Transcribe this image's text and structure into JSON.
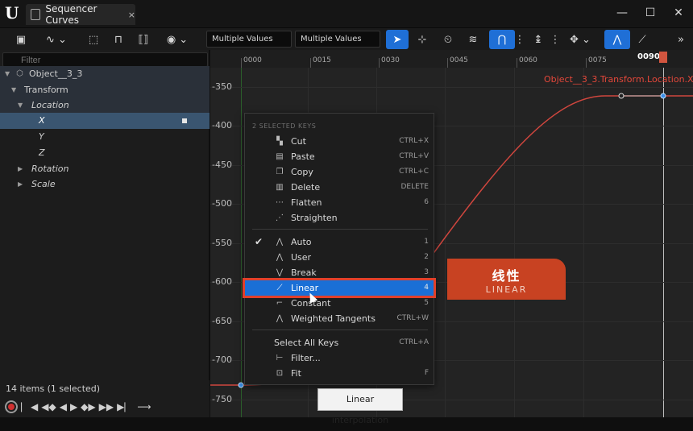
{
  "window": {
    "tab_title": "Sequencer Curves",
    "close_tab": "×",
    "minimize": "—",
    "maximize": "☐",
    "close": "✕"
  },
  "toolbar": {
    "input1": "Multiple Values",
    "input2": "Multiple Values"
  },
  "left_panel": {
    "filter_placeholder": "Filter",
    "tree": [
      {
        "label": "Object__3_3",
        "level": 0
      },
      {
        "label": "Transform",
        "level": 1
      },
      {
        "label": "Location",
        "level": 2
      },
      {
        "label": "X",
        "level": 3,
        "selected": true
      },
      {
        "label": "Y",
        "level": 3
      },
      {
        "label": "Z",
        "level": 3
      },
      {
        "label": "Rotation",
        "level": 2
      },
      {
        "label": "Scale",
        "level": 2
      }
    ],
    "status": "14 items (1 selected)"
  },
  "timeline": {
    "frames": [
      "0000",
      "0015",
      "0030",
      "0045",
      "0060",
      "0075"
    ],
    "playhead": "0090"
  },
  "y_axis": [
    "-350",
    "-400",
    "-450",
    "-500",
    "-550",
    "-600",
    "-650",
    "-700",
    "-750"
  ],
  "curve_name": "Object__3_3.Transform.Location.X",
  "overlay": {
    "cn": "线性",
    "en": "LINEAR"
  },
  "context_menu": {
    "header": "2 SELECTED KEYS",
    "items": [
      {
        "label": "Cut",
        "shortcut": "CTRL+X"
      },
      {
        "label": "Paste",
        "shortcut": "CTRL+V"
      },
      {
        "label": "Copy",
        "shortcut": "CTRL+C"
      },
      {
        "label": "Delete",
        "shortcut": "DELETE"
      },
      {
        "label": "Flatten",
        "shortcut": "6"
      },
      {
        "label": "Straighten",
        "shortcut": ""
      },
      {
        "label": "Auto",
        "shortcut": "1",
        "checked": true
      },
      {
        "label": "User",
        "shortcut": "2"
      },
      {
        "label": "Break",
        "shortcut": "3"
      },
      {
        "label": "Linear",
        "shortcut": "4",
        "highlighted": true
      },
      {
        "label": "Constant",
        "shortcut": "5"
      },
      {
        "label": "Weighted Tangents",
        "shortcut": "CTRL+W"
      },
      {
        "label": "Select All Keys",
        "shortcut": "CTRL+A"
      },
      {
        "label": "Filter...",
        "shortcut": ""
      },
      {
        "label": "Fit",
        "shortcut": "F"
      }
    ],
    "checkmark": "✔"
  },
  "tooltip": "Linear interpolation",
  "colors": {
    "accent": "#1a6fd6",
    "curve": "#d0463e",
    "highlight_outline": "#e0402a",
    "overlay": "#c84222"
  }
}
